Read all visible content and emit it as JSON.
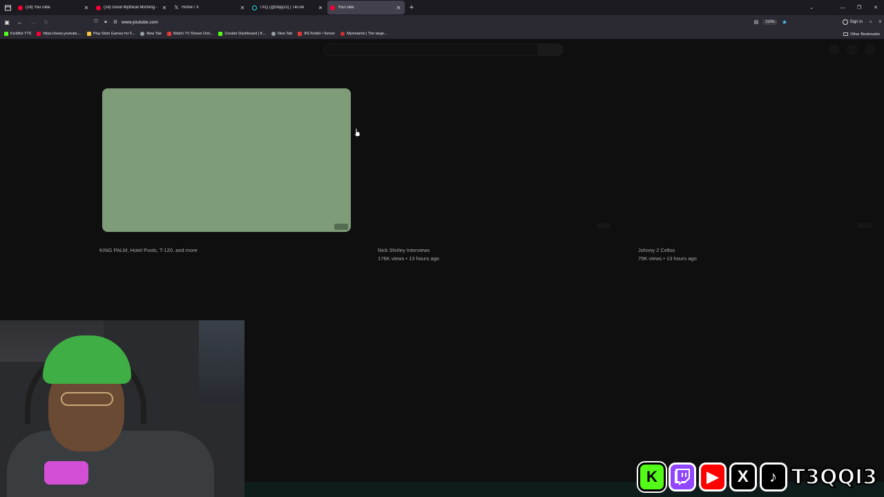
{
  "browser": {
    "tabs": [
      {
        "label": "(18) YouTube",
        "favicon": "youtube-icon",
        "active": false
      },
      {
        "label": "(18) Good Mythical Morning - ",
        "favicon": "youtube-icon",
        "active": false
      },
      {
        "label": "Home / X",
        "favicon": "x-icon",
        "active": false
      },
      {
        "label": "TXQ (@t3qq13) | TikTok",
        "favicon": "tiktok-icon",
        "active": false
      },
      {
        "label": "YouTube",
        "favicon": "youtube-icon",
        "active": true
      }
    ],
    "new_tab": "+",
    "url": "www.youtube.com",
    "zoom": "110%",
    "sign_in": "Sign in",
    "bookmarks": [
      {
        "label": "KickBot TTS",
        "color": "#53fc18"
      },
      {
        "label": "https://www.youtube....",
        "color": "#ff0033"
      },
      {
        "label": "Play Slots Games for F...",
        "color": "#f5c542"
      },
      {
        "label": "New Tab",
        "color": "#9aa0a6"
      },
      {
        "label": "Watch TV Shows Onli...",
        "color": "#e53935"
      },
      {
        "label": "Creator Dashboard | K...",
        "color": "#53fc18"
      },
      {
        "label": "New Tab",
        "color": "#9aa0a6"
      },
      {
        "label": "IRLToolkit • Server",
        "color": "#e53935"
      },
      {
        "label": "Myinstants | The large...",
        "color": "#d32f2f"
      }
    ],
    "other_bookmarks": "Other Bookmarks"
  },
  "youtube": {
    "cards": [
      {
        "channel": "KING PALM, Hotel Pools, T-120, and more",
        "meta": ""
      },
      {
        "channel": "Nick Shirley Interviews",
        "meta": "176K views • 13 hours ago"
      },
      {
        "channel": "Johnny 2 Cellos",
        "meta": "79K views • 13 hours ago"
      }
    ]
  },
  "overlay": {
    "handle": "T3QQI3",
    "socials": [
      {
        "name": "kick-icon",
        "glyph": "K"
      },
      {
        "name": "twitch-icon",
        "glyph": "▮▮"
      },
      {
        "name": "youtube-icon",
        "glyph": "▶"
      },
      {
        "name": "x-icon",
        "glyph": "X"
      },
      {
        "name": "tiktok-icon",
        "glyph": "♪"
      }
    ]
  },
  "colors": {
    "page_bg": "#0f0f0f",
    "thumbnail": "#7f9c78",
    "tab_active": "#42414d",
    "accent_star": "#4fc3f7"
  }
}
